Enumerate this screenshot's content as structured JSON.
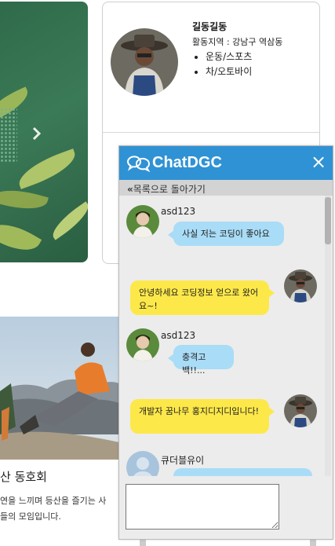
{
  "profile": {
    "name": "길동길동",
    "area": "활동지역 : 강남구 역삼동",
    "tags": [
      "운동/스포츠",
      "차/오토바이"
    ]
  },
  "carousel": {
    "next_icon": "chevron-right-icon"
  },
  "club": {
    "title": "산 동호회",
    "desc_line1": "연을 느끼며 등산을 즐기는 사",
    "desc_line2": "들의 모임입니다."
  },
  "chat": {
    "title": "ChatDGC",
    "close_icon": "×",
    "back_label": "목록으로 돌아가기",
    "back_icon": "«",
    "accent_color": "#2f92d4",
    "bubble_blue": "#a9dcf6",
    "bubble_yellow": "#fde84a",
    "messages": [
      {
        "side": "left",
        "user": "asd123",
        "text": "사실 저는 코딩이 좋아요"
      },
      {
        "side": "right",
        "user": "",
        "text": "안녕하세요 코딩정보 얻으로 왔어요~!"
      },
      {
        "side": "left",
        "user": "asd123",
        "text": "충격고백!!..."
      },
      {
        "side": "right",
        "user": "",
        "text": "개발자 꿈나무 홍지디지디입니다!"
      },
      {
        "side": "left",
        "user": "큐더블유이",
        "text": ""
      }
    ],
    "input_value": ""
  }
}
